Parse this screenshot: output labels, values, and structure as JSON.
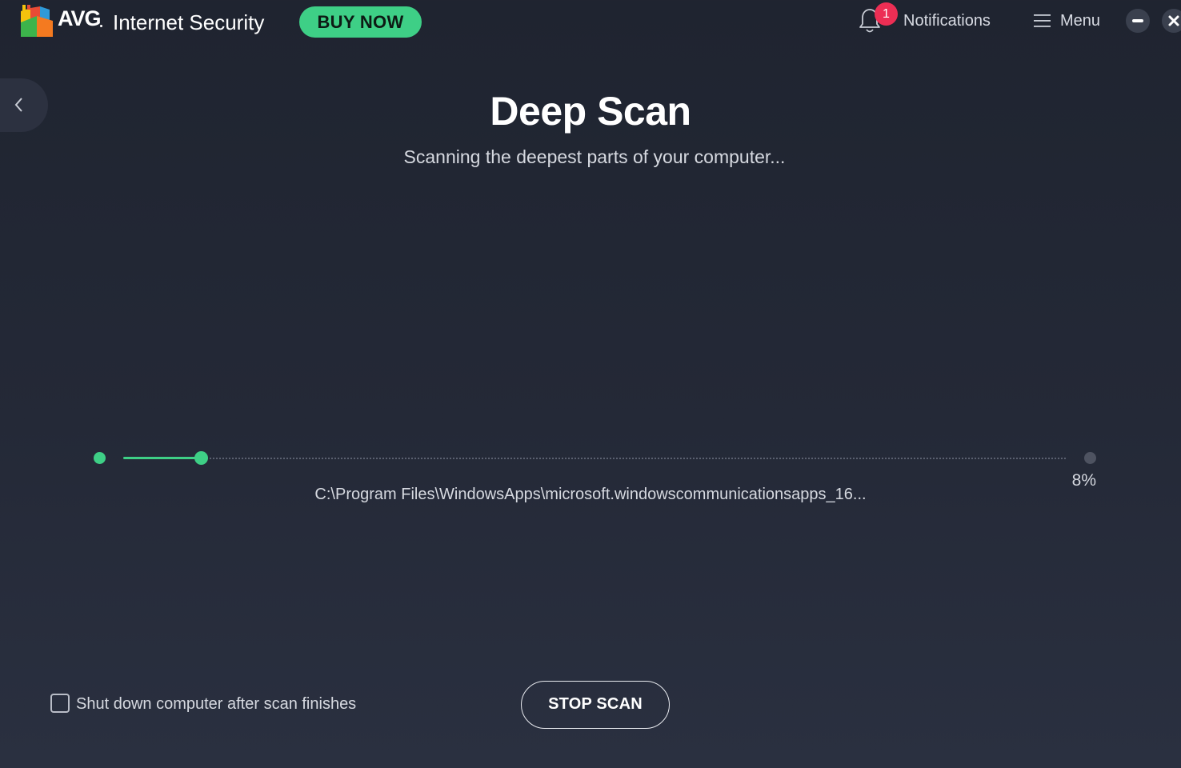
{
  "header": {
    "brand": "AVG",
    "product": "Internet Security",
    "buy_label": "BUY NOW",
    "notifications_badge": "1",
    "notifications_label": "Notifications",
    "menu_label": "Menu"
  },
  "scan": {
    "title": "Deep Scan",
    "subtitle": "Scanning the deepest parts of your computer...",
    "progress_percent": 8,
    "progress_label": "8%",
    "current_path": "C:\\Program Files\\WindowsApps\\microsoft.windowscommunicationsapps_16..."
  },
  "footer": {
    "shutdown_label": "Shut down computer after scan finishes",
    "shutdown_checked": false,
    "stop_label": "STOP SCAN"
  },
  "colors": {
    "accent": "#3ecf86",
    "badge": "#ec2e54",
    "background": "#242937"
  },
  "icons": {
    "logo": "avg-logo-icon",
    "notifications": "bell-icon",
    "menu": "hamburger-icon",
    "minimize": "minimize-icon",
    "close": "close-icon",
    "back": "chevron-left-icon"
  }
}
